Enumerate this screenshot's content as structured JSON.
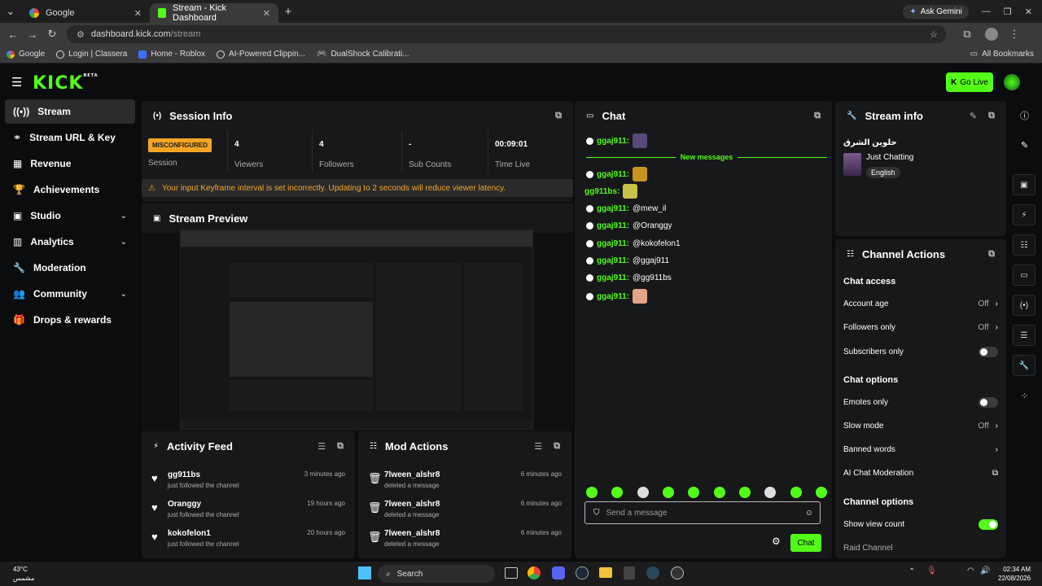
{
  "browser": {
    "tabs": [
      {
        "title": "Google"
      },
      {
        "title": "Stream - Kick Dashboard"
      }
    ],
    "ask_gemini": "Ask Gemini",
    "url_host": "dashboard.kick.com",
    "url_path": "/stream",
    "bookmarks": [
      "Google",
      "Login | Classera",
      "Home - Roblox",
      "AI-Powered Clippin...",
      "DualShock Calibrati..."
    ],
    "all_bookmarks": "All Bookmarks"
  },
  "header": {
    "logo": "KICK",
    "logo_sup": "BETA",
    "go_live": "Go Live"
  },
  "sidebar": {
    "items": [
      {
        "label": "Stream",
        "icon": "stream-icon"
      },
      {
        "label": "Stream URL & Key",
        "icon": "link-icon"
      },
      {
        "label": "Revenue",
        "icon": "revenue-icon"
      },
      {
        "label": "Achievements",
        "icon": "trophy-icon"
      },
      {
        "label": "Studio",
        "icon": "studio-icon"
      },
      {
        "label": "Analytics",
        "icon": "analytics-icon"
      },
      {
        "label": "Moderation",
        "icon": "wrench-icon"
      },
      {
        "label": "Community",
        "icon": "community-icon"
      },
      {
        "label": "Drops & rewards",
        "icon": "gift-icon"
      }
    ]
  },
  "session": {
    "title": "Session Info",
    "status_badge": "MISCONFIGURED",
    "status_label": "Session",
    "viewers_value": "4",
    "viewers_label": "Viewers",
    "followers_value": "4",
    "followers_label": "Followers",
    "subs_value": "-",
    "subs_label": "Sub Counts",
    "time_value": "00:09:01",
    "time_label": "Time Live",
    "warning": "Your input Keyframe interval is set incorrectly. Updating to 2 seconds will reduce viewer latency."
  },
  "preview": {
    "title": "Stream Preview"
  },
  "activity": {
    "title": "Activity Feed",
    "rows": [
      {
        "name": "gg911bs",
        "desc": "just followed the channel",
        "time": "3 minutes ago"
      },
      {
        "name": "Oranggy",
        "desc": "just followed the channel",
        "time": "19 hours ago"
      },
      {
        "name": "kokofelon1",
        "desc": "just followed the channel",
        "time": "20 hours ago"
      }
    ]
  },
  "mod_actions": {
    "title": "Mod Actions",
    "rows": [
      {
        "name": "7lween_alshr8",
        "desc": "deleted a message",
        "time": "6 minutes ago"
      },
      {
        "name": "7lween_alshr8",
        "desc": "deleted a message",
        "time": "6 minutes ago"
      },
      {
        "name": "7lween_alshr8",
        "desc": "deleted a message",
        "time": "6 minutes ago"
      }
    ]
  },
  "chat": {
    "title": "Chat",
    "new_messages": "New messages",
    "messages": [
      {
        "user": "ggaj911:",
        "text": ""
      },
      {
        "user": "ggaj911:",
        "text": ""
      },
      {
        "user": "gg911bs:",
        "text": ""
      },
      {
        "user": "ggaj911:",
        "text": "@mew_il"
      },
      {
        "user": "ggaj911:",
        "text": "@Oranggy"
      },
      {
        "user": "ggaj911:",
        "text": "@kokofelon1"
      },
      {
        "user": "ggaj911:",
        "text": "@ggaj911"
      },
      {
        "user": "ggaj911:",
        "text": "@gg911bs"
      },
      {
        "user": "ggaj911:",
        "text": ""
      }
    ],
    "input_placeholder": "Send a message",
    "send_label": "Chat"
  },
  "stream_info": {
    "title": "Stream info",
    "stream_title": "حلوين الشرق",
    "category": "Just Chatting",
    "language": "English"
  },
  "channel_actions": {
    "title": "Channel Actions",
    "chat_access": "Chat access",
    "account_age": "Account age",
    "account_age_value": "Off",
    "followers_only": "Followers only",
    "followers_only_value": "Off",
    "subscribers_only": "Subscribers only",
    "chat_options": "Chat options",
    "emotes_only": "Emotes only",
    "slow_mode": "Slow mode",
    "slow_mode_value": "Off",
    "banned_words": "Banned words",
    "ai_moderation": "AI Chat Moderation",
    "channel_options": "Channel options",
    "show_view_count": "Show view count",
    "raid_channel": "Raid Channel"
  },
  "taskbar": {
    "weather_temp": "43°C",
    "weather_desc": "مشمس",
    "search": "Search",
    "time": "02:34 AM",
    "date": "22/08/2026"
  },
  "colors": {
    "accent": "#53fc18",
    "warning": "#f5a524",
    "panel": "#17181a",
    "background": "#0b0c0d"
  }
}
